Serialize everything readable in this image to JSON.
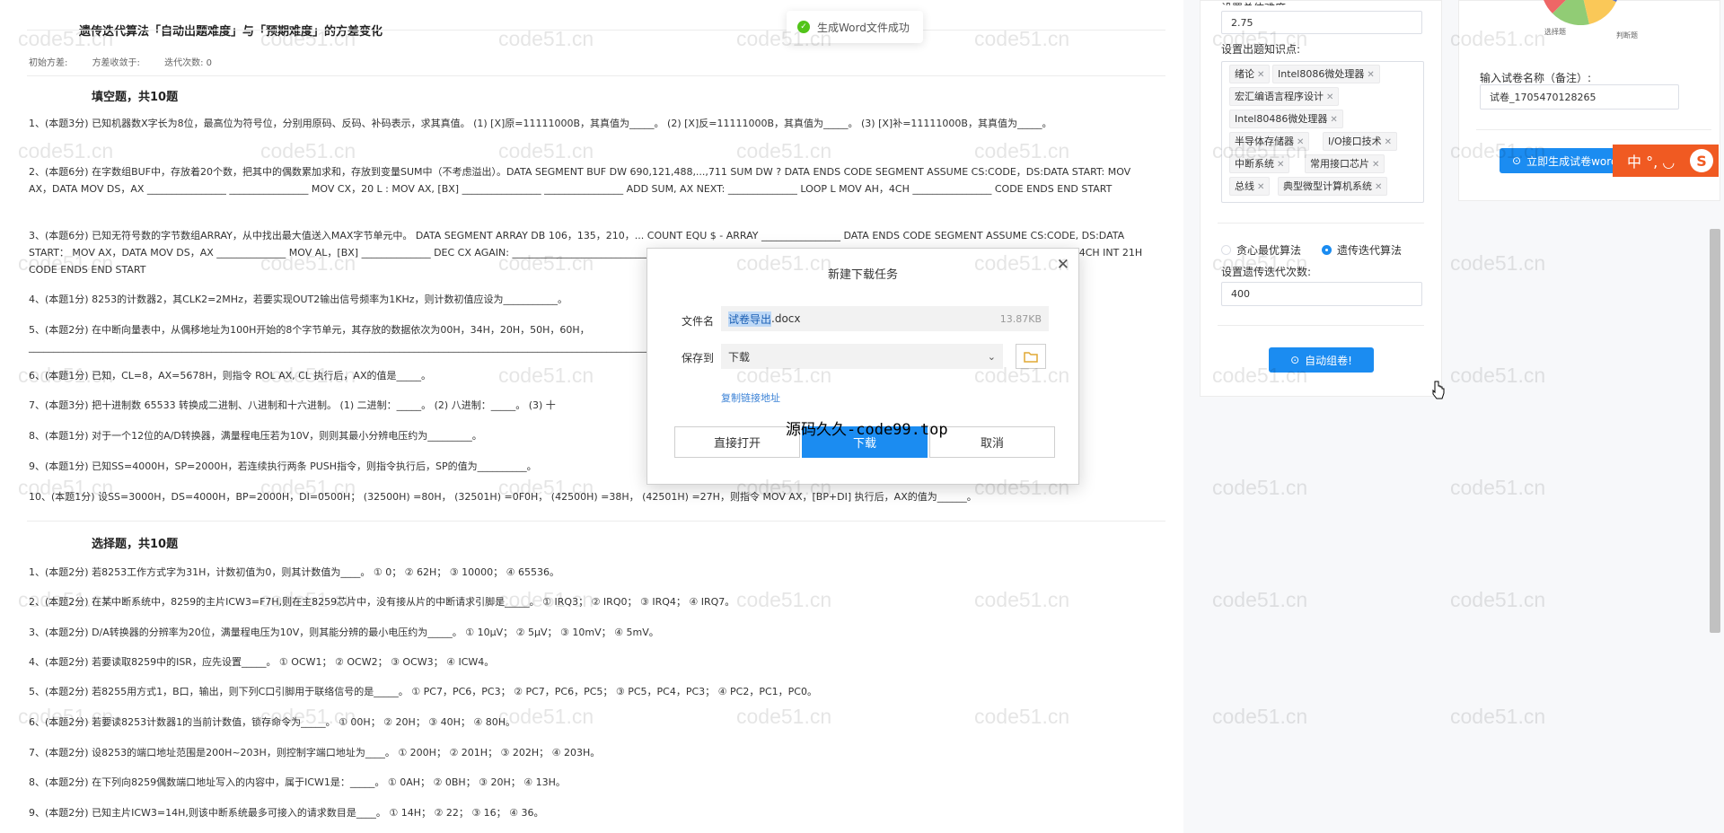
{
  "doc": {
    "title": "遗传迭代算法「自动出题难度」与「预期难度」的方差变化",
    "meta": [
      "初始方差:",
      "方差收敛于:",
      "迭代次数: 0"
    ],
    "fill_title": "填空题，共10题",
    "fill_questions": [
      "1、(本题3分) 已知机器数X字长为8位，最高位为符号位，分别用原码、反码、补码表示，求其真值。 (1) [X]原=11111000B，其真值为_____。 (2) [X]反=11111000B，其真值为_____。 (3) [X]补=11111000B，其真值为_____。",
      "2、(本题6分) 在字数组BUF中，存放着20个数，把其中的偶数累加求和，存放到变量SUM中（不考虑溢出）。DATA SEGMENT BUF DW 690,121,488,...,711 SUM DW ? DATA ENDS CODE SEGMENT ASSUME CS:CODE，DS:DATA START: MOV AX，DATA MOV DS，AX ________________ ________________ MOV CX，20 L : MOV AX, [BX] ________________ ________________ ADD SUM, AX NEXT: ______________ LOOP L MOV AH，4CH ________________ CODE ENDS END START",
      "3、(本题6分) 已知无符号数的字节数组ARRAY，从中找出最大值送入MAX字节单元中。 DATA SEGMENT ARRAY DB 106，135，210，... COUNT EQU $ - ARRAY ________________ DATA ENDS CODE SEGMENT ASSUME CS:CODE, DS:DATA START： MOV AX，DATA MOV DS，AX ______________ MOV AL，[BX] ______________ DEC CX AGAIN: ________________________________________________________________________________________________________ MOV AH，4CH INT 21H CODE ENDS END START",
      "4、(本题1分) 8253的计数器2，其CLK2=2MHz，若要实现OUT2输出信号频率为1KHz，则计数初值应设为___________。",
      "5、(本题2分) 在中断向量表中，从偶移地址为100H开始的8个字节单元，其存放的数据依次为00H，34H，20H，50H，60H，_______________________________________________________________________________________________________________________________________________________________________，或其物理地址为________。",
      "6、(本题1分) 已知，CL=8，AX=5678H，则指令 ROL AX, CL 执行后，AX的值是_____。",
      "7、(本题3分) 把十进制数 65533 转换成二进制、八进制和十六进制。 (1) 二进制：_____。 (2) 八进制：_____。 (3) 十",
      "8、(本题1分) 对于一个12位的A/D转换器，满量程电压若为10V，则则其最小分辨电压约为_________。",
      "9、(本题1分) 已知SS=4000H，SP=2000H，若连续执行两条 PUSH指令，则指令执行后，SP的值为__________。",
      "10、(本题1分) 设SS=3000H，DS=4000H，BP=2000H，DI=0500H； (32500H) =80H， (32501H) =0F0H， (42500H) =38H， (42501H) =27H，则指令 MOV AX，[BP+DI] 执行后，AX的值为______。"
    ],
    "choice_title": "选择题，共10题",
    "choice_questions": [
      "1、(本题2分) 若8253工作方式字为31H，计数初值为0，则其计数值为____。 ① 0； ② 62H； ③ 10000； ④ 65536。",
      "2、(本题2分) 在某中断系统中，8259的主片ICW3=F7H,则在主8259芯片中，没有接从片的中断请求引脚是_____。 ① IRQ3； ② IRQ0； ③ IRQ4； ④ IRQ7。",
      "3、(本题2分) D/A转换器的分辨率为20位，满量程电压为10V，则其能分辨的最小电压约为_____。 ① 10μV； ② 5μV； ③ 10mV； ④ 5mV。",
      "4、(本题2分) 若要读取8259中的ISR，应先设置_____。 ① OCW1； ② OCW2； ③ OCW3； ④ ICW4。",
      "5、(本题2分) 若8255用方式1，B口，输出，则下列C口引脚用于联络信号的是_____。 ① PC7，PC6，PC3； ② PC7，PC6，PC5； ③ PC5，PC4，PC3； ④ PC2，PC1，PC0。",
      "6、(本题2分) 若要读8253计数器1的当前计数值，锁存命令为_____。 ① 00H； ② 20H； ③ 40H； ④ 80H。",
      "7、(本题2分) 设8253的端口地址范围是200H~203H，则控制字端口地址为____。 ① 200H； ② 201H； ③ 202H； ④ 203H。",
      "8、(本题2分) 在下列向8259偶数端口地址写入的内容中，属于ICW1是：_____。 ① 0AH； ② 0BH； ③ 20H； ④ 13H。",
      "9、(本题2分) 已知主片ICW3=14H,则该中断系统最多可接入的请求数目是____。 ① 14H； ② 22； ③ 16； ④ 36。"
    ]
  },
  "panel": {
    "difficulty_label": "设置总体难度:",
    "difficulty_value": "2.75",
    "knowledge_label": "设置出题知识点:",
    "tags": [
      "绪论",
      "Intel8086微处理器",
      "宏汇编语言程序设计",
      "Intel80486微处理器",
      "半导体存储器",
      "I/O接口技术",
      "中断系统",
      "常用接口芯片",
      "总线",
      "典型微型计算机系统"
    ],
    "algo_greedy": "贪心最优算法",
    "algo_genetic": "遗传迭代算法",
    "iter_label": "设置遗传迭代次数:",
    "iter_value": "400",
    "auto_btn": "自动组卷!",
    "pie_label_left": "选择题",
    "pie_label_right": "判断题",
    "paper_name_label": "输入试卷名称（备注）:",
    "paper_name_value": "试卷_1705470128265",
    "gen_btn": "立即生成试卷word"
  },
  "toast": {
    "text": "生成Word文件成功"
  },
  "dialog": {
    "title": "新建下载任务",
    "filename_label": "文件名",
    "filename_sel": "试卷导出",
    "filename_ext": ".docx",
    "filesize": "13.87KB",
    "saveto_label": "保存到",
    "saveto_value": "下载",
    "copy_link": "复制链接地址",
    "open_btn": "直接打开",
    "download_btn": "下载",
    "cancel_btn": "取消"
  },
  "overlay": {
    "banner": "源码久久-code99.top",
    "watermark": "code51.cn",
    "ime_text": "中 °, ◡",
    "ime_logo": "S"
  },
  "colors": {
    "primary": "#1b8cf1",
    "success": "#52c41a",
    "ime": "#f05a22"
  }
}
